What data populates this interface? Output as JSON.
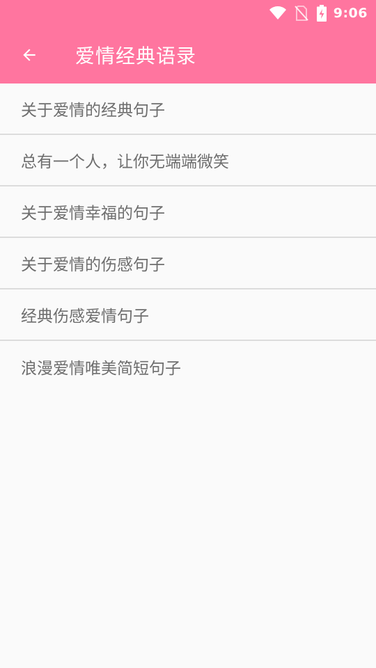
{
  "status_bar": {
    "time": "9:06",
    "icons": [
      "wifi-icon",
      "no-sim-icon",
      "battery-charging-icon"
    ]
  },
  "toolbar": {
    "title": "爱情经典语录",
    "back_icon": "arrow-back-icon"
  },
  "list": {
    "items": [
      {
        "label": "关于爱情的经典句子"
      },
      {
        "label": "总有一个人，让你无端端微笑"
      },
      {
        "label": "关于爱情幸福的句子"
      },
      {
        "label": "关于爱情的伤感句子"
      },
      {
        "label": "经典伤感爱情句子"
      },
      {
        "label": "浪漫爱情唯美简短句子"
      }
    ]
  },
  "colors": {
    "accent": "#FF759F",
    "background": "#FAFAFA",
    "divider": "#DCDCDC",
    "item_text": "#6E6E6E"
  }
}
